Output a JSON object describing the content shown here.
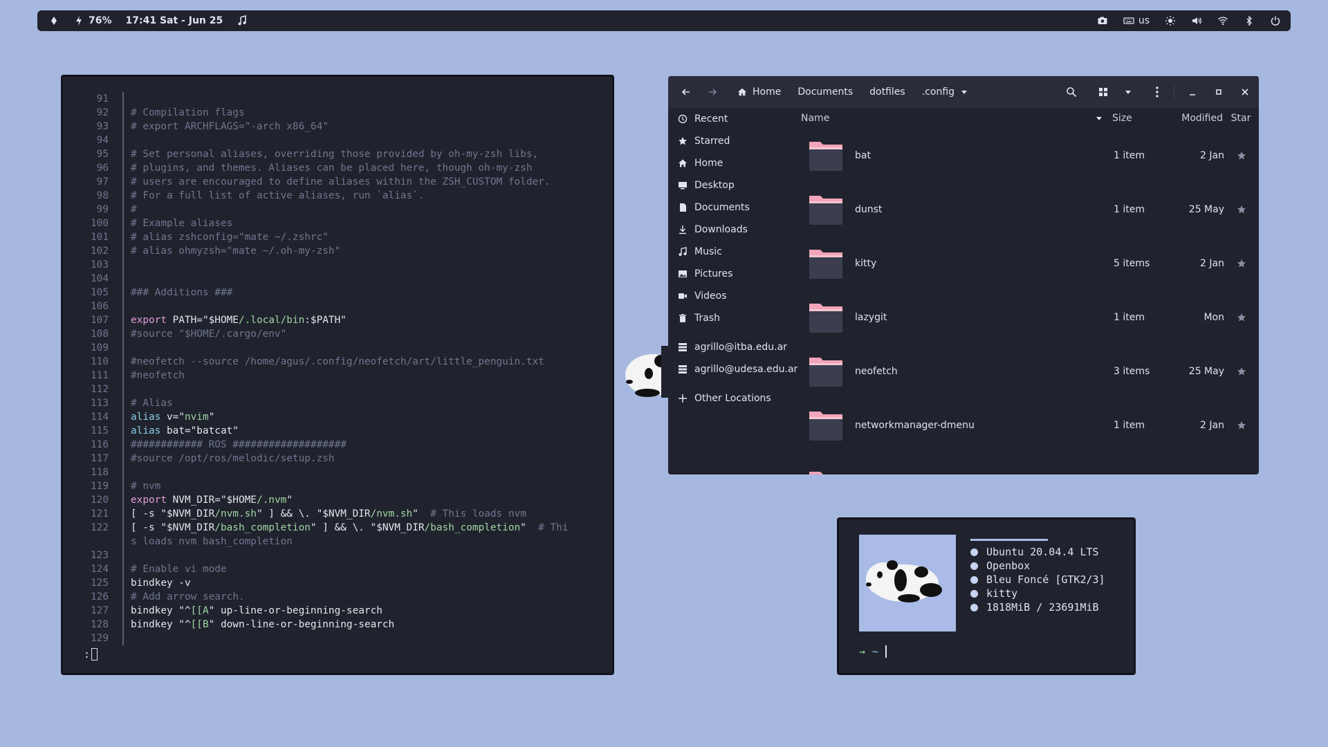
{
  "colors": {
    "desktop": "#a7b8e0",
    "panel": "#20232d",
    "accent": "#a9bbe6",
    "folder_tab": "#f2a4b8"
  },
  "topbar": {
    "battery": "76%",
    "datetime": "17:41 Sat - Jun 25",
    "keyboard_layout": "us",
    "icons": [
      "diamond-icon",
      "bolt-icon",
      "music-note-icon",
      "camera-icon",
      "keyboard-icon",
      "brightness-icon",
      "volume-icon",
      "wifi-icon",
      "bluetooth-icon",
      "power-icon"
    ]
  },
  "editor": {
    "lines": [
      {
        "n": "91",
        "t": ""
      },
      {
        "n": "92",
        "t": "# Compilation flags",
        "c": "com"
      },
      {
        "n": "93",
        "t": "# export ARCHFLAGS=\"-arch x86_64\"",
        "c": "com"
      },
      {
        "n": "94",
        "t": ""
      },
      {
        "n": "95",
        "t": "# Set personal aliases, overriding those provided by oh-my-zsh libs,",
        "c": "com"
      },
      {
        "n": "96",
        "t": "# plugins, and themes. Aliases can be placed here, though oh-my-zsh",
        "c": "com"
      },
      {
        "n": "97",
        "t": "# users are encouraged to define aliases within the ZSH_CUSTOM folder.",
        "c": "com"
      },
      {
        "n": "98",
        "t": "# For a full list of active aliases, run `alias`.",
        "c": "com"
      },
      {
        "n": "99",
        "t": "#",
        "c": "com"
      },
      {
        "n": "100",
        "t": "# Example aliases",
        "c": "com"
      },
      {
        "n": "101",
        "t": "# alias zshconfig=\"mate ~/.zshrc\"",
        "c": "com"
      },
      {
        "n": "102",
        "t": "# alias ohmyzsh=\"mate ~/.oh-my-zsh\"",
        "c": "com"
      },
      {
        "n": "103",
        "t": ""
      },
      {
        "n": "104",
        "t": ""
      },
      {
        "n": "105",
        "t": "### Additions ###",
        "c": "com"
      },
      {
        "n": "106",
        "t": ""
      },
      {
        "n": "107",
        "parts": [
          {
            "t": "export",
            "c": "kw"
          },
          {
            "t": " PATH=\"$HOME",
            "c": "wt"
          },
          {
            "t": "/.local/bin",
            "c": "gr"
          },
          {
            "t": ":$PATH\"",
            "c": "wt"
          }
        ]
      },
      {
        "n": "108",
        "t": "#source \"$HOME/.cargo/env\"",
        "c": "com"
      },
      {
        "n": "109",
        "t": ""
      },
      {
        "n": "110",
        "t": "#neofetch --source /home/agus/.config/neofetch/art/little_penguin.txt",
        "c": "com"
      },
      {
        "n": "111",
        "t": "#neofetch",
        "c": "com"
      },
      {
        "n": "112",
        "t": ""
      },
      {
        "n": "113",
        "t": "# Alias",
        "c": "com"
      },
      {
        "n": "114",
        "parts": [
          {
            "t": "alias",
            "c": "cy"
          },
          {
            "t": " v=\"",
            "c": "wt"
          },
          {
            "t": "nvim",
            "c": "gr"
          },
          {
            "t": "\"",
            "c": "wt"
          }
        ]
      },
      {
        "n": "115",
        "parts": [
          {
            "t": "alias",
            "c": "cy"
          },
          {
            "t": " bat=\"batcat\"",
            "c": "wt"
          }
        ]
      },
      {
        "n": "116",
        "t": "############ ROS ###################",
        "c": "com"
      },
      {
        "n": "117",
        "t": "#source /opt/ros/melodic/setup.zsh",
        "c": "com"
      },
      {
        "n": "118",
        "t": ""
      },
      {
        "n": "119",
        "t": "# nvm",
        "c": "com"
      },
      {
        "n": "120",
        "parts": [
          {
            "t": "export",
            "c": "kw"
          },
          {
            "t": " NVM_DIR=\"$HOME",
            "c": "wt"
          },
          {
            "t": "/.nvm",
            "c": "gr"
          },
          {
            "t": "\"",
            "c": "wt"
          }
        ]
      },
      {
        "n": "121",
        "parts": [
          {
            "t": "[ -s \"$NVM_DIR",
            "c": "wt"
          },
          {
            "t": "/nvm.sh",
            "c": "gr"
          },
          {
            "t": "\" ] && \\. \"$NVM_DIR",
            "c": "wt"
          },
          {
            "t": "/nvm.sh",
            "c": "gr"
          },
          {
            "t": "\"  ",
            "c": "wt"
          },
          {
            "t": "# This loads nvm",
            "c": "com"
          }
        ]
      },
      {
        "n": "122",
        "parts": [
          {
            "t": "[ -s \"$NVM_DIR",
            "c": "wt"
          },
          {
            "t": "/bash_completion",
            "c": "gr"
          },
          {
            "t": "\" ] && \\. \"$NVM_DIR",
            "c": "wt"
          },
          {
            "t": "/bash_completion",
            "c": "gr"
          },
          {
            "t": "\"  ",
            "c": "wt"
          },
          {
            "t": "# Thi",
            "c": "com"
          }
        ]
      },
      {
        "n": "",
        "t": "s loads nvm bash_completion",
        "c": "com"
      },
      {
        "n": "123",
        "t": ""
      },
      {
        "n": "124",
        "t": "# Enable vi mode",
        "c": "com"
      },
      {
        "n": "125",
        "t": "bindkey -v",
        "c": "wt"
      },
      {
        "n": "126",
        "t": "# Add arrow search.",
        "c": "com"
      },
      {
        "n": "127",
        "parts": [
          {
            "t": "bindkey \"^",
            "c": "wt"
          },
          {
            "t": "[[A",
            "c": "gr"
          },
          {
            "t": "\" up-line-or-beginning-search",
            "c": "wt"
          }
        ]
      },
      {
        "n": "128",
        "parts": [
          {
            "t": "bindkey \"^",
            "c": "wt"
          },
          {
            "t": "[[B",
            "c": "gr"
          },
          {
            "t": "\" down-line-or-beginning-search",
            "c": "wt"
          }
        ]
      },
      {
        "n": "129",
        "t": ""
      }
    ],
    "command_prompt": ":"
  },
  "files": {
    "nav": {
      "back": "back-arrow-icon",
      "forward": "forward-arrow-icon"
    },
    "breadcrumbs": [
      "Home",
      "Documents",
      "dotfiles",
      ".config"
    ],
    "columns": {
      "name": "Name",
      "size": "Size",
      "modified": "Modified",
      "star": "Star"
    },
    "sidebar": [
      {
        "label": "Recent",
        "icon": "clock-icon"
      },
      {
        "label": "Starred",
        "icon": "star-icon"
      },
      {
        "label": "Home",
        "icon": "home-icon"
      },
      {
        "label": "Desktop",
        "icon": "desktop-icon"
      },
      {
        "label": "Documents",
        "icon": "document-icon"
      },
      {
        "label": "Downloads",
        "icon": "download-icon"
      },
      {
        "label": "Music",
        "icon": "music-icon"
      },
      {
        "label": "Pictures",
        "icon": "picture-icon"
      },
      {
        "label": "Videos",
        "icon": "video-icon"
      },
      {
        "label": "Trash",
        "icon": "trash-icon"
      },
      {
        "label": "agrillo@itba.edu.ar",
        "icon": "network-drive-icon"
      },
      {
        "label": "agrillo@udesa.edu.ar",
        "icon": "network-drive-icon"
      },
      {
        "label": "Other Locations",
        "icon": "plus-icon"
      }
    ],
    "rows": [
      {
        "name": "bat",
        "size": "1 item",
        "modified": "2 Jan"
      },
      {
        "name": "dunst",
        "size": "1 item",
        "modified": "25 May"
      },
      {
        "name": "kitty",
        "size": "5 items",
        "modified": "2 Jan"
      },
      {
        "name": "lazygit",
        "size": "1 item",
        "modified": "Mon"
      },
      {
        "name": "neofetch",
        "size": "3 items",
        "modified": "25 May"
      },
      {
        "name": "networkmanager-dmenu",
        "size": "1 item",
        "modified": "2 Jan"
      }
    ]
  },
  "neofetch": {
    "info": [
      "Ubuntu 20.04.4 LTS",
      "Openbox",
      "Bleu Foncé [GTK2/3]",
      "kitty",
      "1818MiB / 23691MiB"
    ],
    "prompt_arrow": "→",
    "prompt_dir": "~"
  }
}
